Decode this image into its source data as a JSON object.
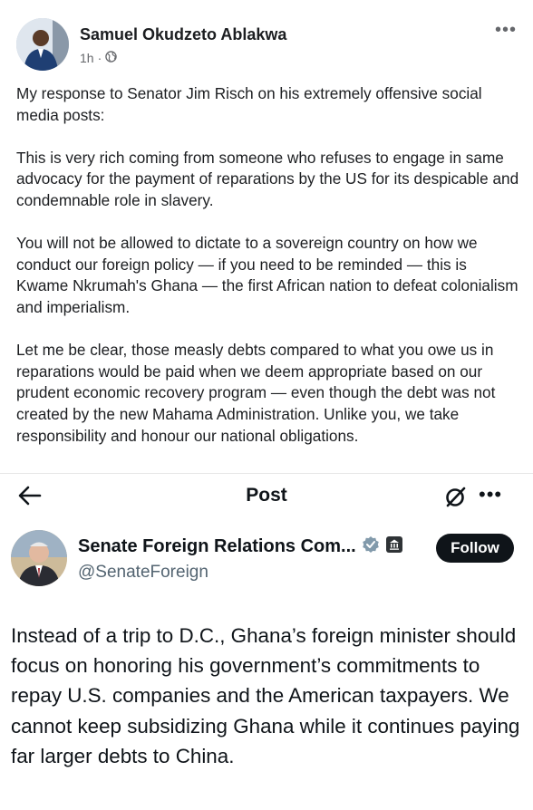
{
  "facebook_post": {
    "author": "Samuel Okudzeto Ablakwa",
    "time": "1h",
    "separator": "·",
    "more_label": "•••",
    "paragraphs": [
      "My response to Senator Jim Risch on his extremely offensive social media posts:",
      "This is very rich coming from someone who refuses to engage in same advocacy for the payment of reparations by the US for its despicable and condemnable role in slavery.",
      "You will not be allowed to dictate to a sovereign country on how we conduct our foreign policy — if you need to be reminded — this is Kwame Nkrumah's Ghana — the first African nation to defeat colonialism and imperialism.",
      "Let me be clear, those measly debts compared to what you owe us in reparations would be paid when we deem appropriate based on our prudent economic recovery program — even though the debt was not created by the new Mahama Administration. Unlike you, we take responsibility and honour our national obligations."
    ]
  },
  "x_post": {
    "header_title": "Post",
    "more_label": "•••",
    "account_name": "Senate Foreign Relations Com...",
    "handle": "@SenateForeign",
    "follow_label": "Follow",
    "text": "Instead of a trip to D.C., Ghana’s foreign minister should focus on honoring his government’s commitments to repay U.S. companies and the American taxpayers. We cannot keep subsidizing Ghana while it continues paying far larger debts to China."
  },
  "colors": {
    "fb_text": "#1c1e21",
    "fb_meta": "#65676b",
    "x_text": "#0f1419",
    "x_handle": "#536471",
    "verified_badge": "#829aab",
    "follow_bg": "#0f1419"
  },
  "icons": [
    "globe-icon",
    "more-icon",
    "back-arrow-icon",
    "grok-icon",
    "verified-badge-icon",
    "government-label-icon"
  ]
}
